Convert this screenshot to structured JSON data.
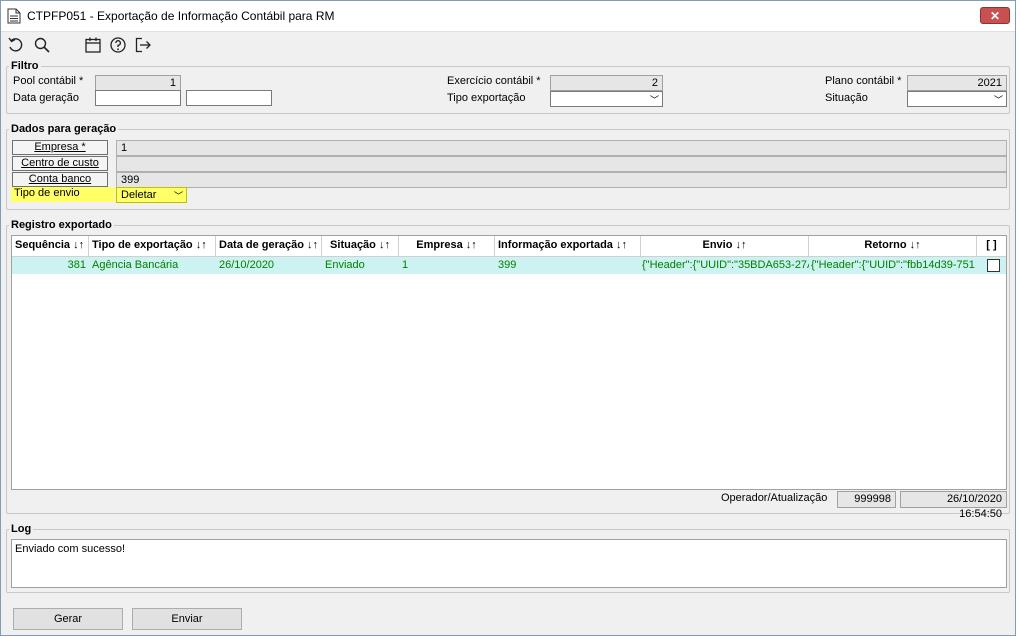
{
  "window": {
    "title": "CTPFP051 - Exportação de Informação Contábil para RM",
    "close_glyph": "✕"
  },
  "toolbar": {
    "icons": [
      "undo-icon",
      "search-icon",
      "calendar-icon",
      "help-icon",
      "exit-icon"
    ]
  },
  "filtro": {
    "title": "Filtro",
    "pool_label": "Pool contábil *",
    "pool_value": "1",
    "data_label": "Data geração",
    "data_from": "",
    "data_to": "",
    "exercicio_label": "Exercício contábil *",
    "exercicio_value": "2",
    "tipo_label": "Tipo exportação",
    "tipo_value": "",
    "plano_label": "Plano contábil *",
    "plano_value": "2021",
    "situacao_label": "Situação",
    "situacao_value": ""
  },
  "dados": {
    "title": "Dados para geração",
    "empresa_label": "Empresa *",
    "empresa_value": "1",
    "centro_label": "Centro de custo",
    "centro_value": "",
    "conta_label": "Conta banco",
    "conta_value": "399",
    "tipo_envio_label": "Tipo de envio",
    "tipo_envio_value": "Deletar",
    "highlight_color": "#ffff66"
  },
  "registro": {
    "title": "Registro exportado",
    "columns": [
      "Sequência ↓↑",
      "Tipo de exportação ↓↑",
      "Data de geração ↓↑",
      "Situação ↓↑",
      "Empresa ↓↑",
      "Informação exportada ↓↑",
      "Envio ↓↑",
      "Retorno ↓↑",
      "[ ]"
    ],
    "rows": [
      {
        "sequencia": "381",
        "tipo": "Agência Bancária",
        "data": "26/10/2020",
        "situacao": "Enviado",
        "empresa": "1",
        "info": "399",
        "envio": "{\"Header\":{\"UUID\":\"35BDA653-27A",
        "retorno": "{\"Header\":{\"UUID\":\"fbb14d39-751"
      }
    ],
    "operador_label": "Operador/Atualização",
    "operador_value": "999998",
    "atualizacao_value": "26/10/2020 16:54:50"
  },
  "log": {
    "title": "Log",
    "text": "Enviado com sucesso!"
  },
  "buttons": {
    "gerar": "Gerar",
    "enviar": "Enviar"
  }
}
